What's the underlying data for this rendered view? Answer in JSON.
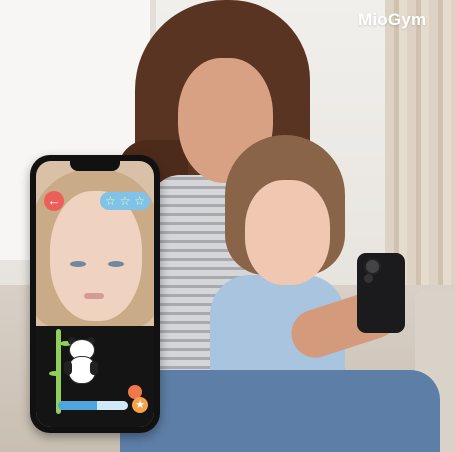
{
  "brand": {
    "logo_text": "MioGym",
    "color": "#ffffff"
  },
  "phone_screen": {
    "back_icon": "arrow-left-icon",
    "back_color": "#ea6058",
    "stars": {
      "total": 3,
      "icon": "star-outline-icon",
      "pill_color": "#7fc3ea"
    },
    "mascot": "panda-icon",
    "progress": {
      "fraction": 0.55,
      "fill_color": "#4ea6dd"
    },
    "badge_icon": "star-badge-icon"
  }
}
